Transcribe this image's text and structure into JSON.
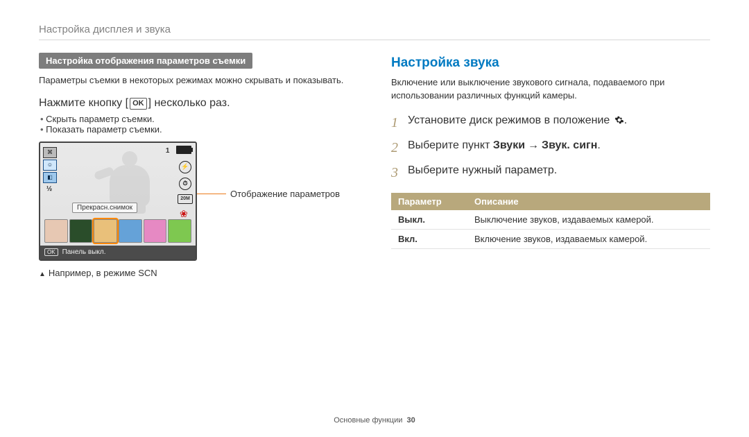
{
  "breadcrumb": "Настройка дисплея и звука",
  "left": {
    "section_bar": "Настройка отображения параметров съемки",
    "desc": "Параметры съемки в некоторых режимах можно скрывать и показывать.",
    "press_prefix": "Нажмите кнопку [",
    "press_ok": "OK",
    "press_suffix": "] несколько раз.",
    "bullets": [
      "Скрыть параметр съемки.",
      "Показать параметр съемки."
    ],
    "lcd": {
      "tooltip": "Прекрасн.снимок",
      "status_ok": "OK",
      "status_text": "Панель выкл.",
      "thumb_colors": [
        "#e7c8b3",
        "#2a4d2a",
        "#e9c07a",
        "#65a2d8",
        "#e689c3",
        "#7ec850"
      ],
      "selected_thumb": 2
    },
    "callout": "Отображение параметров",
    "caption": "Например, в режиме SCN"
  },
  "right": {
    "heading": "Настройка звука",
    "desc": "Включение или выключение звукового сигнала, подаваемого при использовании различных функций камеры.",
    "steps": {
      "s1_pre": "Установите диск режимов в положение ",
      "s1_post": ".",
      "s2_pre": "Выберите пункт ",
      "s2_b1": "Звуки",
      "s2_arrow": "→",
      "s2_b2": "Звук. сигн",
      "s2_post": ".",
      "s3": "Выберите нужный параметр."
    },
    "table": {
      "h1": "Параметр",
      "h2": "Описание",
      "rows": [
        {
          "k": "Выкл.",
          "v": "Выключение звуков, издаваемых камерой."
        },
        {
          "k": "Вкл.",
          "v": "Включение звуков, издаваемых камерой."
        }
      ]
    }
  },
  "footer": {
    "section": "Основные функции",
    "page": "30"
  }
}
